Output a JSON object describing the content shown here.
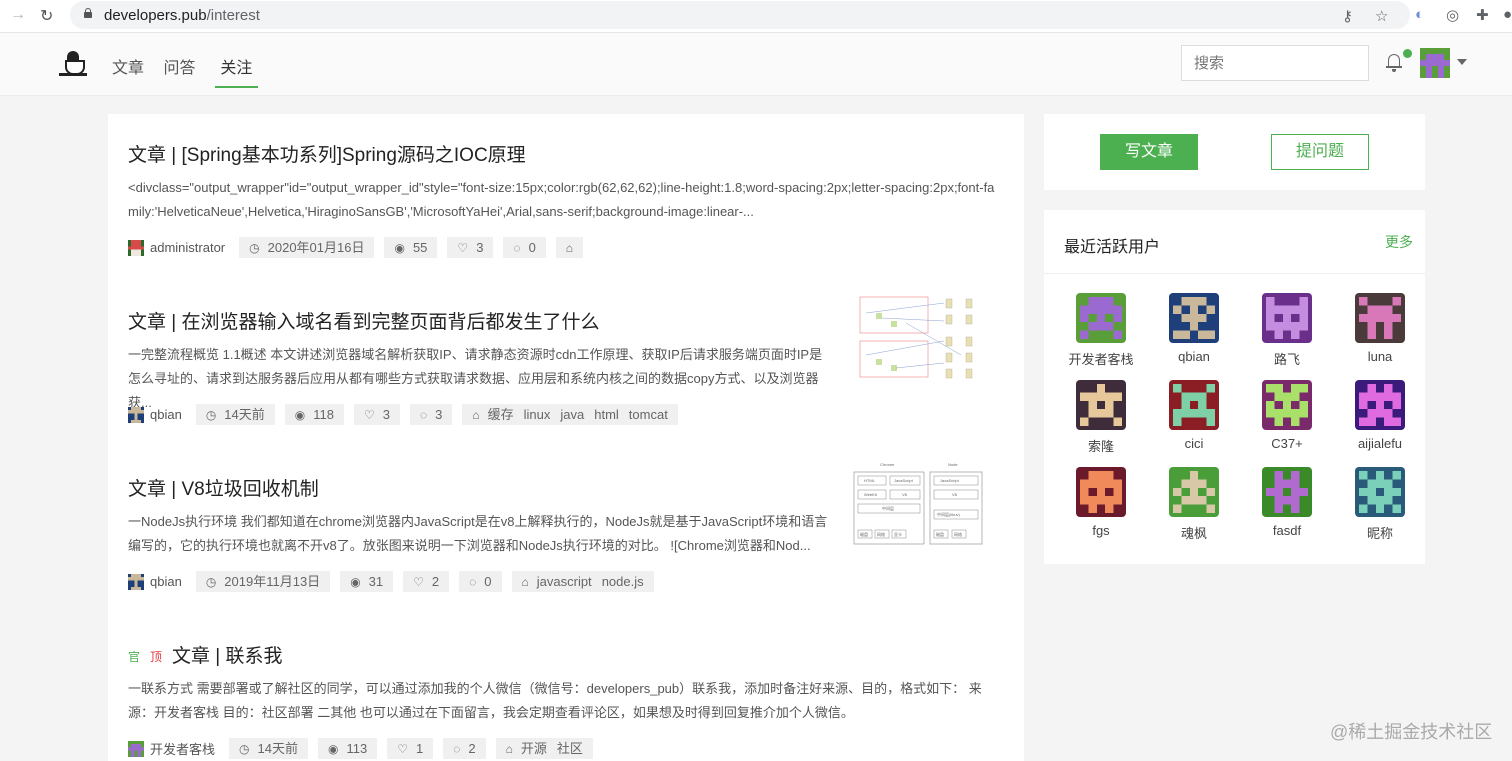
{
  "browser": {
    "url_domain": "developers.pub",
    "url_path": "/interest"
  },
  "header": {
    "nav": [
      "文章",
      "问答",
      "关注"
    ],
    "search_placeholder": "搜索"
  },
  "articles": [
    {
      "title": "文章 | [Spring基本功系列]Spring源码之IOC原理",
      "excerpt": "<divclass=\"output_wrapper\"id=\"output_wrapper_id\"style=\"font-size:15px;color:rgb(62,62,62);line-height:1.8;word-spacing:2px;letter-spacing:2px;font-family:'HelveticaNeue',Helvetica,'HiraginoSansGB','MicrosoftYaHei',Arial,sans-serif;background-image:linear-...",
      "author": "administrator",
      "date": "2020年01月16日",
      "views": "55",
      "likes": "3",
      "comments": "0",
      "tags": []
    },
    {
      "title": "文章 | 在浏览器输入域名看到完整页面背后都发生了什么",
      "excerpt": "一完整流程概览 1.1概述 本文讲述浏览器域名解析获取IP、请求静态资源时cdn工作原理、获取IP后请求服务端页面时IP是怎么寻址的、请求到达服务器后应用从都有哪些方式获取请求数据、应用层和系统内核之间的数据copy方式、以及浏览器获...",
      "author": "qbian",
      "date": "14天前",
      "views": "118",
      "likes": "3",
      "comments": "3",
      "tags": [
        "缓存",
        "linux",
        "java",
        "html",
        "tomcat"
      ]
    },
    {
      "title": "文章 | V8垃圾回收机制",
      "excerpt": "一NodeJs执行环境 我们都知道在chrome浏览器内JavaScript是在v8上解释执行的，NodeJs就是基于JavaScript环境和语言编写的，它的执行环境也就离不开v8了。放张图来说明一下浏览器和NodeJs执行环境的对比。 ![Chrome浏览器和Nod...",
      "author": "qbian",
      "date": "2019年11月13日",
      "views": "31",
      "likes": "2",
      "comments": "0",
      "tags": [
        "javascript",
        "node.js"
      ]
    },
    {
      "badge_official": "官",
      "badge_top": "顶",
      "title": "文章 | 联系我",
      "excerpt": "一联系方式 需要部署或了解社区的同学，可以通过添加我的个人微信（微信号：developers_pub）联系我，添加时备注好来源、目的，格式如下： 来源：开发者客栈 目的：社区部署 二其他 也可以通过在下面留言，我会定期查看评论区，如果想及时得到回复推介加个人微信。",
      "author": "开发者客栈",
      "date": "14天前",
      "views": "113",
      "likes": "1",
      "comments": "2",
      "tags": [
        "开源",
        "社区"
      ]
    }
  ],
  "diagram_chrome": {
    "col1": "Chrome",
    "col2": "Node",
    "html": "HTML",
    "js": "JavaScript",
    "webkit": "WebKit",
    "v8": "V8",
    "mid": "中间层",
    "mid2": "中间层(libuv)",
    "b1": "磁盘",
    "b2": "网络",
    "b3": "显卡",
    "b4": "磁盘",
    "b5": "网络"
  },
  "sidebar": {
    "write_button": "写文章",
    "ask_button": "提问题",
    "active_title": "最近活跃用户",
    "more": "更多",
    "users": [
      {
        "name": "开发者客栈",
        "bg": "#5a9e3a",
        "fg": "#9b6ad0"
      },
      {
        "name": "qbian",
        "bg": "#1f3f7a",
        "fg": "#c9b99a"
      },
      {
        "name": "路飞",
        "bg": "#6a2f8a",
        "fg": "#c58de0"
      },
      {
        "name": "luna",
        "bg": "#4a3a3a",
        "fg": "#d878b8"
      },
      {
        "name": "索隆",
        "bg": "#3e2c3a",
        "fg": "#e6c89a"
      },
      {
        "name": "cici",
        "bg": "#8a1e24",
        "fg": "#7ed0a6"
      },
      {
        "name": "C37+",
        "bg": "#7a2a6a",
        "fg": "#a8e06a"
      },
      {
        "name": "aijialefu",
        "bg": "#3a1a7a",
        "fg": "#e06ae0"
      },
      {
        "name": "fgs",
        "bg": "#6a1a2a",
        "fg": "#f08a5a"
      },
      {
        "name": "魂枫",
        "bg": "#4a9e3a",
        "fg": "#d8c8a8"
      },
      {
        "name": "fasdf",
        "bg": "#3a8a2a",
        "fg": "#b06ad0"
      },
      {
        "name": "昵称",
        "bg": "#2a5a7a",
        "fg": "#7ad0b8"
      }
    ]
  },
  "watermark": "@稀土掘金技术社区"
}
